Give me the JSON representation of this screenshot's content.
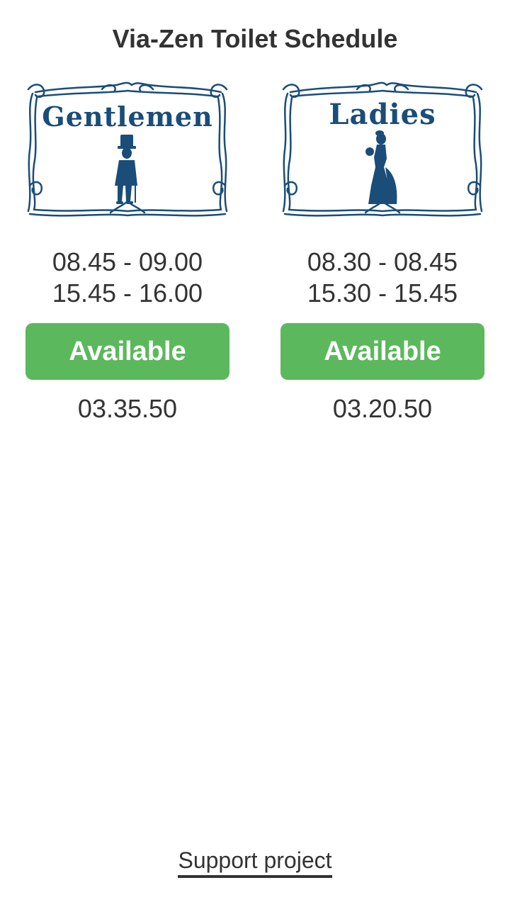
{
  "header": {
    "title": "Via-Zen Toilet Schedule"
  },
  "colors": {
    "available": "#5cb85c",
    "sign_blue": "#1a4d78"
  },
  "gentlemen": {
    "sign_label": "Gentlemen",
    "icon": "gentleman-silhouette-icon",
    "times": [
      "08.45 - 09.00",
      "15.45 - 16.00"
    ],
    "status": "Available",
    "countdown": "03.35.50"
  },
  "ladies": {
    "sign_label": "Ladies",
    "icon": "lady-silhouette-icon",
    "times": [
      "08.30 - 08.45",
      "15.30 - 15.45"
    ],
    "status": "Available",
    "countdown": "03.20.50"
  },
  "footer": {
    "support_label": "Support project"
  }
}
